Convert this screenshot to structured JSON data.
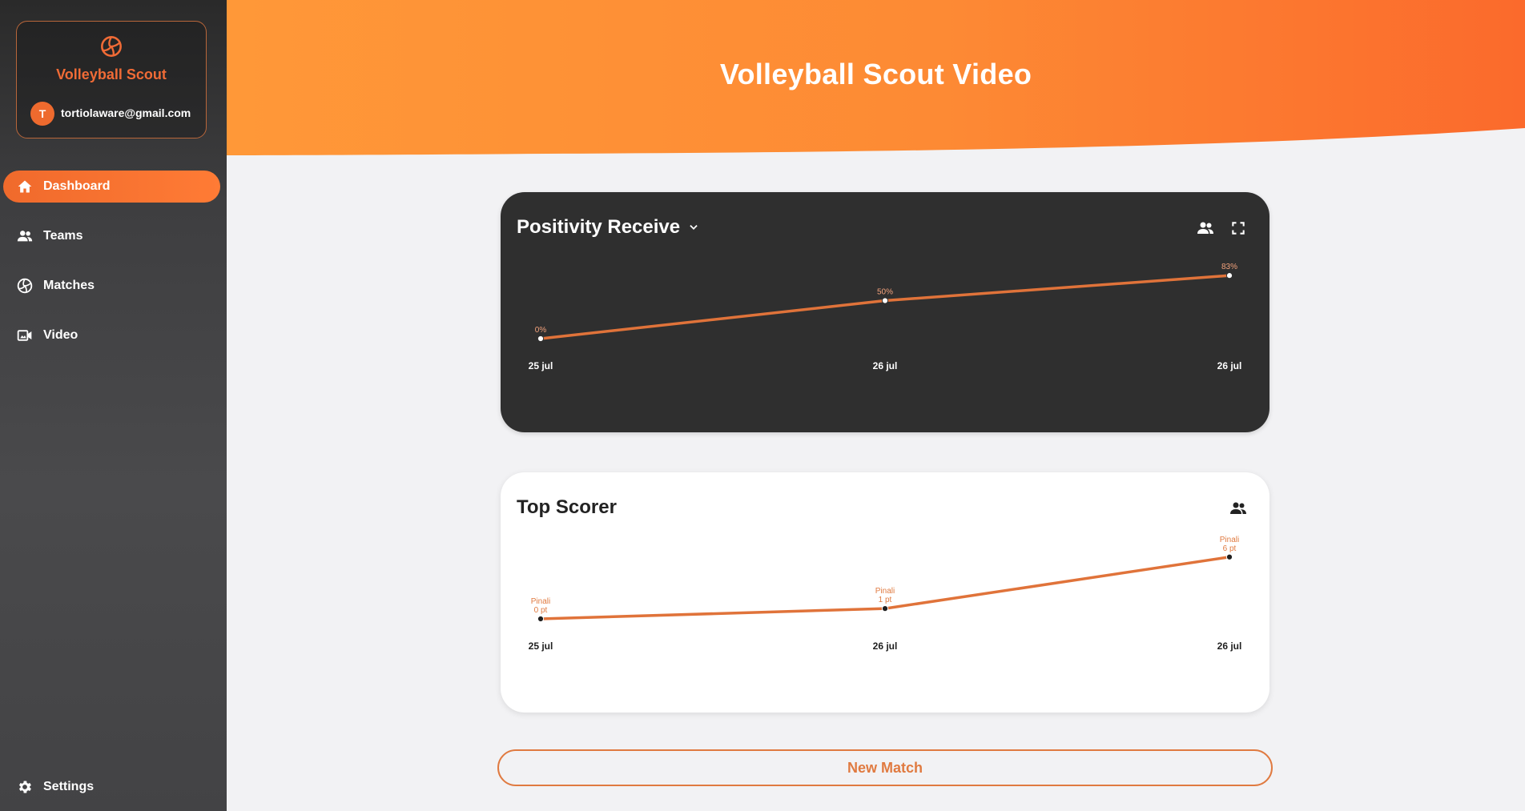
{
  "brand": {
    "name": "Volleyball Scout",
    "icon": "volleyball-icon"
  },
  "user": {
    "initial": "T",
    "email": "tortiolaware@gmail.com"
  },
  "nav": {
    "items": [
      {
        "label": "Dashboard",
        "icon": "home-icon",
        "active": true
      },
      {
        "label": "Teams",
        "icon": "people-icon",
        "active": false
      },
      {
        "label": "Matches",
        "icon": "volleyball-icon",
        "active": false
      },
      {
        "label": "Video",
        "icon": "video-camera-icon",
        "active": false
      }
    ],
    "settings_label": "Settings"
  },
  "header": {
    "title": "Volleyball Scout Video"
  },
  "colors": {
    "accent": "#f06a2c",
    "line": "#e0733a",
    "card_dark": "#2f2f2f",
    "header_gradient_start": "#ff9838",
    "header_gradient_end": "#fb6a2c"
  },
  "positivity_card": {
    "title": "Positivity Receive",
    "icons": [
      "people-icon",
      "fullscreen-icon"
    ]
  },
  "top_scorer_card": {
    "title": "Top Scorer",
    "icons": [
      "people-icon"
    ]
  },
  "new_match_label": "New Match",
  "chart_data": [
    {
      "type": "line",
      "title": "Positivity Receive",
      "x": [
        "25 jul",
        "26 jul",
        "26 jul"
      ],
      "values": [
        0,
        50,
        83
      ],
      "data_labels": [
        "0%",
        "50%",
        "83%"
      ],
      "ylim": [
        0,
        100
      ],
      "grid": false
    },
    {
      "type": "line",
      "title": "Top Scorer",
      "x": [
        "25 jul",
        "26 jul",
        "26 jul"
      ],
      "values": [
        0,
        1,
        6
      ],
      "data_labels": [
        [
          "Pinali",
          "0 pt"
        ],
        [
          "Pinali",
          "1 pt"
        ],
        [
          "Pinali",
          "6 pt"
        ]
      ],
      "ylim": [
        0,
        8
      ],
      "grid": false
    }
  ]
}
